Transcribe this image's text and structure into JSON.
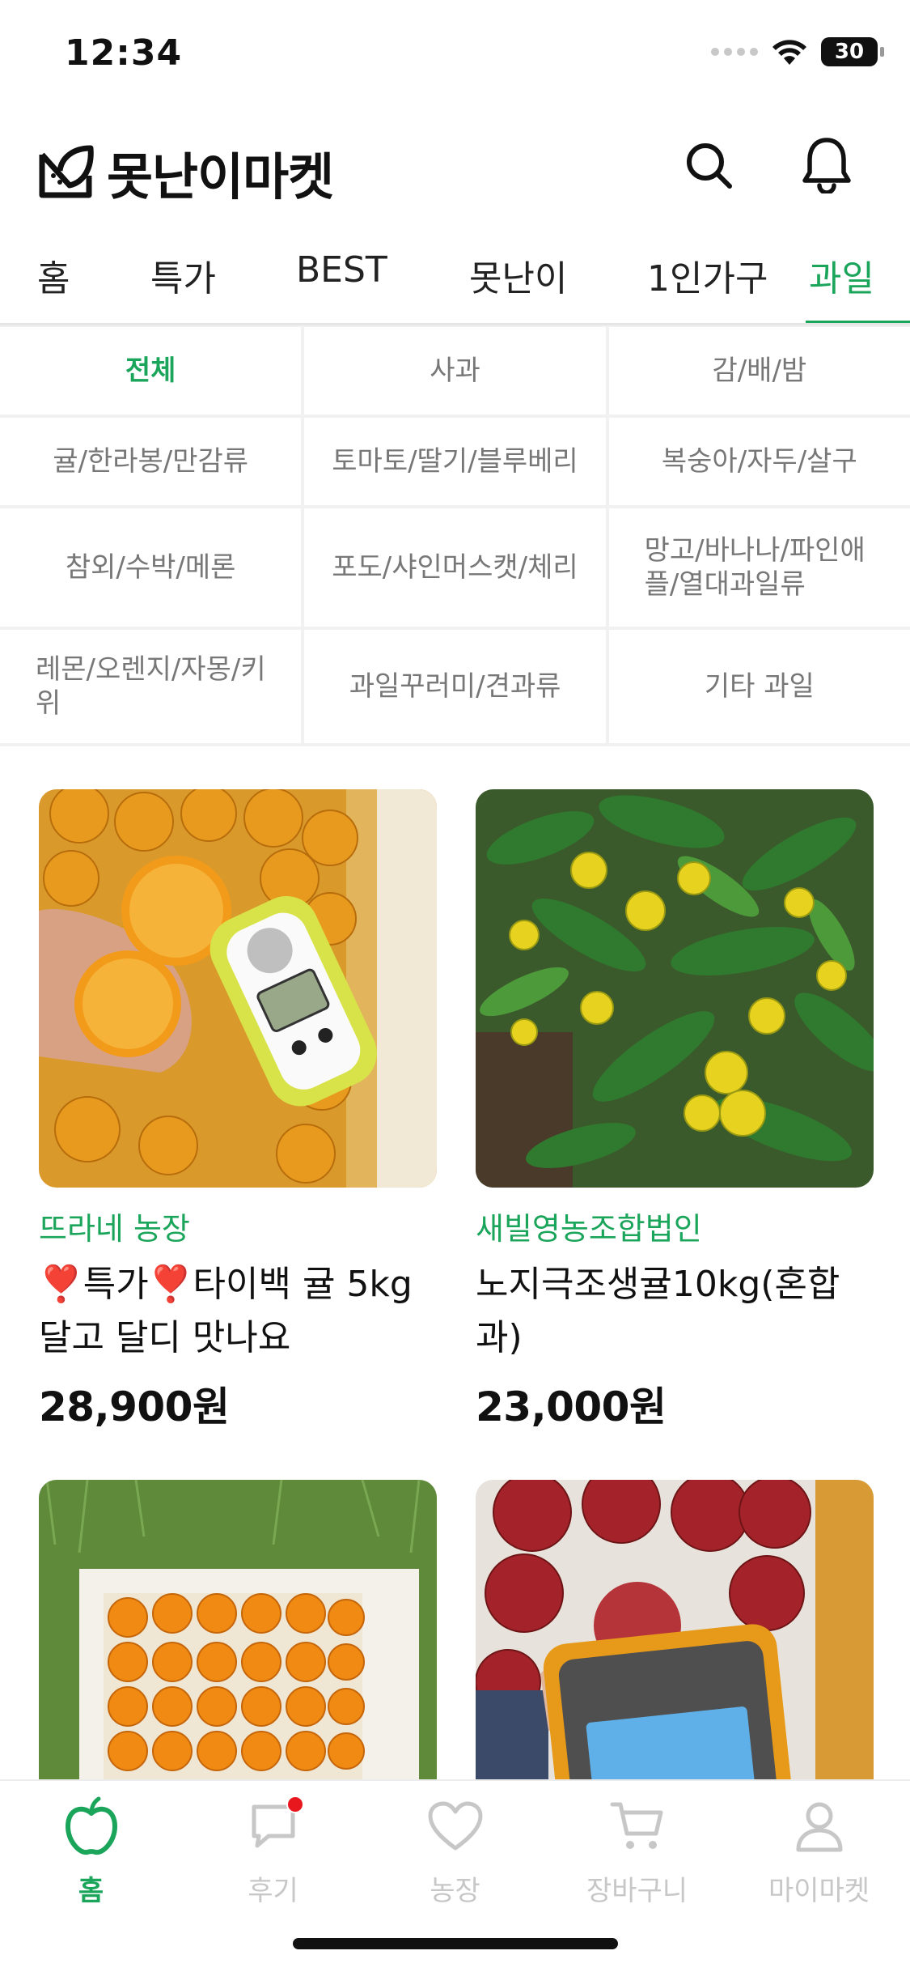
{
  "status_bar": {
    "time": "12:34",
    "battery": "30"
  },
  "header": {
    "title": "못난이마켓",
    "logo_icon": "leaf-box-icon",
    "search_icon": "search-icon",
    "bell_icon": "bell-icon"
  },
  "tabs": [
    {
      "label": "홈"
    },
    {
      "label": "특가"
    },
    {
      "label": "BEST"
    },
    {
      "label": "못난이"
    },
    {
      "label": "1인가구"
    },
    {
      "label": "과일",
      "active": true
    }
  ],
  "subcategories": [
    {
      "label": "전체",
      "active": true
    },
    {
      "label": "사과"
    },
    {
      "label": "감/배/밤"
    },
    {
      "label": "귤/한라봉/만감류"
    },
    {
      "label": "토마토/딸기/블루베리"
    },
    {
      "label": "복숭아/자두/살구"
    },
    {
      "label": "참외/수박/메론"
    },
    {
      "label": "포도/샤인머스캣/체리"
    },
    {
      "label": "망고/바나나/파인애플/열대과일류"
    },
    {
      "label": "레몬/오렌지/자몽/키위"
    },
    {
      "label": "과일꾸러미/견과류"
    },
    {
      "label": "기타 과일"
    }
  ],
  "products": [
    {
      "farm": "뜨라네 농장",
      "name": "❣️특가❣️타이백 귤 5kg 달고 달디 맛나요",
      "price": "28,900원"
    },
    {
      "farm": "새빌영농조합법인",
      "name": "노지극조생귤10kg(혼합과)",
      "price": "23,000원"
    },
    {
      "farm": "",
      "name": "",
      "price": ""
    },
    {
      "farm": "",
      "name": "",
      "price": ""
    }
  ],
  "colors": {
    "accent": "#1aa55b",
    "badge": "#e8171d"
  },
  "bottom_nav": [
    {
      "label": "홈",
      "icon": "apple-icon",
      "active": true
    },
    {
      "label": "후기",
      "icon": "chat-bubble-icon",
      "badge": true
    },
    {
      "label": "농장",
      "icon": "heart-icon"
    },
    {
      "label": "장바구니",
      "icon": "cart-icon"
    },
    {
      "label": "마이마켓",
      "icon": "person-icon"
    }
  ]
}
